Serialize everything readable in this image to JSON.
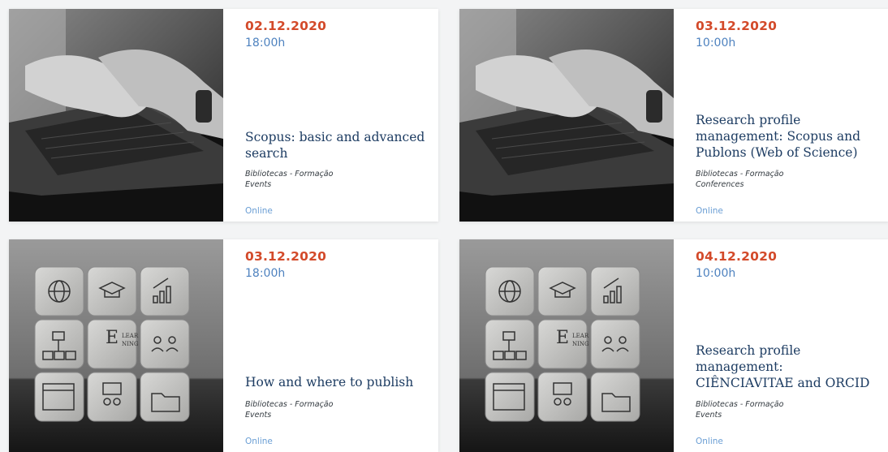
{
  "events": [
    {
      "date": "02.12.2020",
      "time": "18:00h",
      "title": "Scopus: basic and advanced search",
      "category": "Bibliotecas - Formação",
      "type": "Events",
      "location": "Online",
      "image": "laptop-typing-photo"
    },
    {
      "date": "03.12.2020",
      "time": "10:00h",
      "title": "Research profile management: Scopus and Publons (Web of Science)",
      "category": "Bibliotecas - Formação",
      "type": "Conferences",
      "location": "Online",
      "image": "laptop-typing-photo"
    },
    {
      "date": "03.12.2020",
      "time": "18:00h",
      "title": "How and where to publish",
      "category": "Bibliotecas - Formação",
      "type": "Events",
      "location": "Online",
      "image": "elearning-blocks-photo"
    },
    {
      "date": "04.12.2020",
      "time": "10:00h",
      "title": "Research profile management: CIÊNCIAVITAE and ORCID",
      "category": "Bibliotecas - Formação",
      "type": "Events",
      "location": "Online",
      "image": "elearning-blocks-photo"
    }
  ],
  "elearning_block": {
    "line1": "LEAR",
    "line2": "NING",
    "initial": "E"
  },
  "colors": {
    "date": "#d34a2a",
    "time": "#4e82bf",
    "title": "#1d3c62",
    "location": "#6a9ed4"
  }
}
